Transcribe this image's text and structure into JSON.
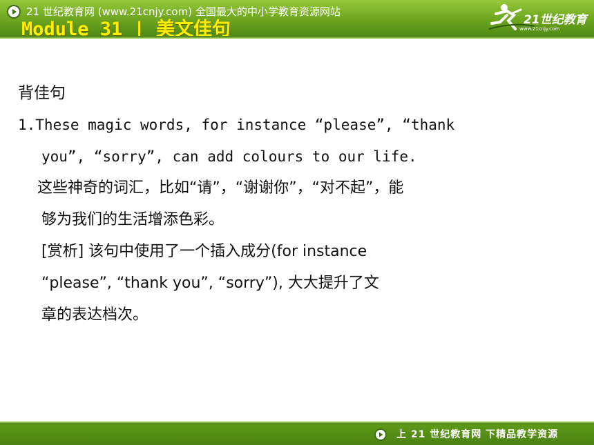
{
  "header": {
    "site_title": "21 世纪教育网 (www.21cnjy.com)  全国最大的中小学教育资源网站",
    "module_title": "Module 31  | 美文佳句",
    "logo_text": "21世纪教育",
    "logo_slogan": "www.21cnjy.com"
  },
  "content": {
    "heading": "背佳句",
    "line1": "1.These magic words, for instance “please”, “thank",
    "line2": "you”,  “sorry”, can add colours to our life.",
    "translation1": "这些神奇的词汇，比如“请”，“谢谢你”，“对不起”，能",
    "translation2": "够为我们的生活增添色彩。",
    "analysis1": "[赏析] 该句中使用了一个插入成分(for instance",
    "analysis2": "“please”, “thank you”,  “sorry”), 大大提升了文",
    "analysis3": "章的表达档次。"
  },
  "footer": {
    "text": "上 21 世纪教育网  下精品教学资源"
  },
  "colors": {
    "header_green": "#6da51f",
    "module_title_yellow": "#ffee00",
    "footer_green": "#4a8112"
  },
  "icons": {
    "header_play": "play-circle-icon",
    "footer_play": "play-circle-icon",
    "logo": "running-figure-logo"
  }
}
